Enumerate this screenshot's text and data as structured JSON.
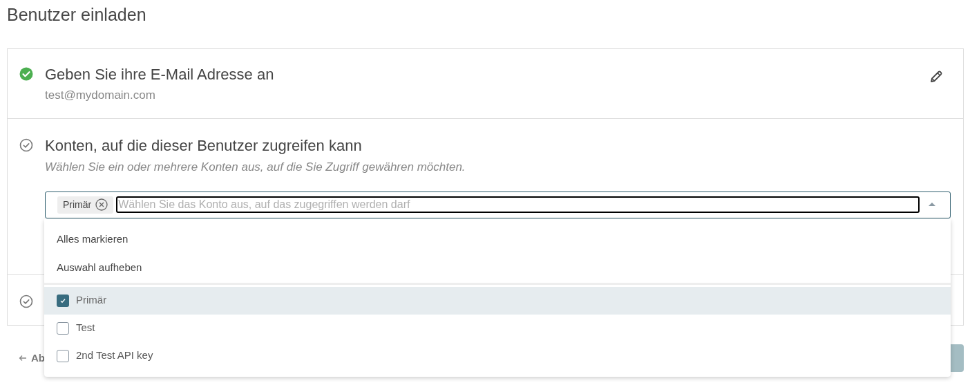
{
  "page_title": "Benutzer einladen",
  "steps": [
    {
      "completed": true,
      "title": "Geben Sie ihre E-Mail Adresse an",
      "value": "test@mydomain.com",
      "editable": true
    },
    {
      "completed": false,
      "title": "Konten, auf die dieser Benutzer zugreifen kann",
      "description": "Wählen Sie ein oder mehrere Konten aus, auf die Sie Zugriff gewähren möchten.",
      "select": {
        "chips": [
          "Primär"
        ],
        "placeholder": "Wählen Sie das Konto aus, auf das zugegriffen werden darf",
        "expanded": true,
        "actions": [
          "Alles markieren",
          "Auswahl aufheben"
        ],
        "options": [
          {
            "label": "Primär",
            "checked": true,
            "selected": true
          },
          {
            "label": "Test",
            "checked": false,
            "selected": false
          },
          {
            "label": "2nd Test API key",
            "checked": false,
            "selected": false
          }
        ]
      }
    },
    {
      "completed": false
    }
  ],
  "back_link": "Ab"
}
